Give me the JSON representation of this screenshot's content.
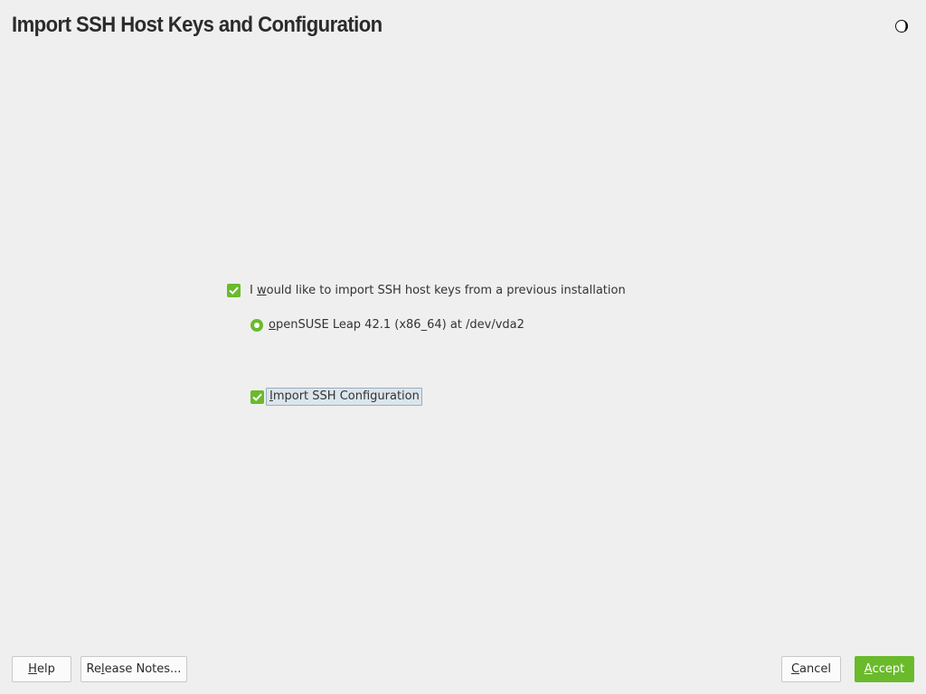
{
  "header": {
    "title": "Import SSH Host Keys and Configuration",
    "theme_toggle_icon": "contrast-moon-icon"
  },
  "options": {
    "import_keys": {
      "checked": true,
      "label_pre": "I ",
      "label_mnemonic": "w",
      "label_post": "ould like to import SSH host keys from a previous installation"
    },
    "installation": {
      "selected": true,
      "label_mnemonic": "o",
      "label_post": "penSUSE Leap 42.1 (x86_64) at /dev/vda2"
    },
    "import_config": {
      "checked": true,
      "label_mnemonic": "I",
      "label_post": "mport SSH Configuration"
    }
  },
  "footer": {
    "help": {
      "mnemonic": "H",
      "rest": "elp"
    },
    "release_notes": {
      "pre": "Re",
      "mnemonic": "l",
      "rest": "ease Notes..."
    },
    "cancel": {
      "mnemonic": "C",
      "rest": "ancel"
    },
    "accept": {
      "mnemonic": "A",
      "rest": "ccept"
    }
  },
  "colors": {
    "accent": "#6aba2c",
    "background": "#efefef",
    "focus_box": "#dbe5ec"
  }
}
